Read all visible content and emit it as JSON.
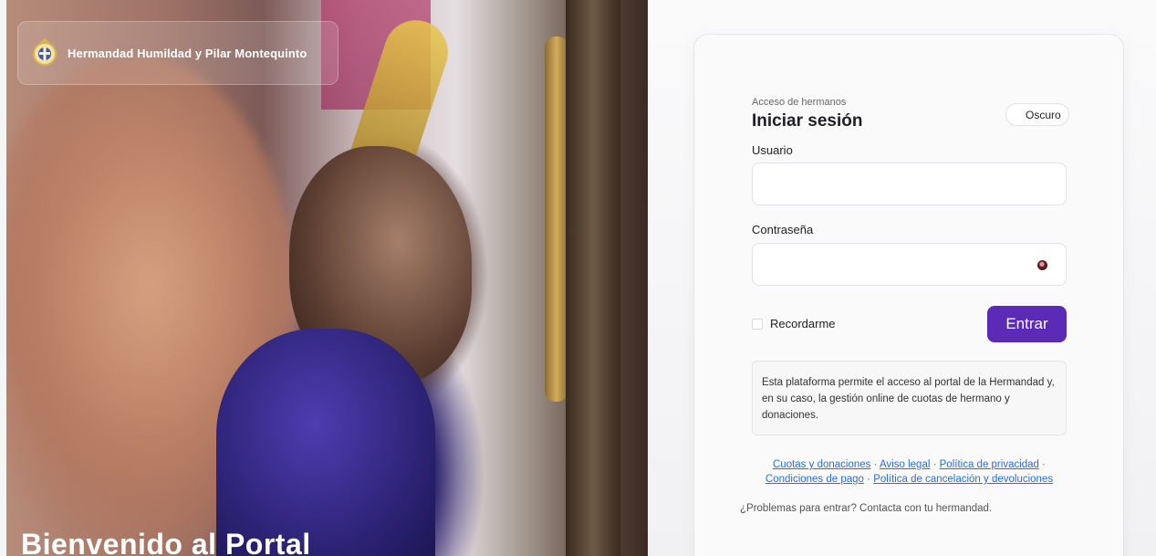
{
  "brand": {
    "name": "Hermandad Humildad y Pilar Montequinto"
  },
  "hero": {
    "title": "Bienvenido al Portal"
  },
  "login": {
    "subtitle": "Acceso de hermanos",
    "title": "Iniciar sesión",
    "theme_toggle_label": "Oscuro",
    "username_label": "Usuario",
    "username_value": "",
    "password_label": "Contraseña",
    "password_value": "",
    "remember_label": "Recordarme",
    "submit_label": "Entrar",
    "info_text": "Esta plataforma permite el acceso al portal de la Hermandad y, en su caso, la gestión online de cuotas de hermano y donaciones.",
    "links": {
      "cuotas": "Cuotas y donaciones",
      "aviso": "Aviso legal",
      "privacidad": "Política de privacidad",
      "pago": "Condiciones de pago",
      "cancelacion": "Política de cancelación y devoluciones",
      "separator": " · "
    },
    "help_text": "¿Problemas para entrar? Contacta con tu hermandad."
  },
  "colors": {
    "accent": "#5b2bb8",
    "link": "#2c6ed8"
  },
  "icons": {
    "brand": "crest-icon",
    "theme": "moon-icon",
    "password": "eye-icon"
  }
}
